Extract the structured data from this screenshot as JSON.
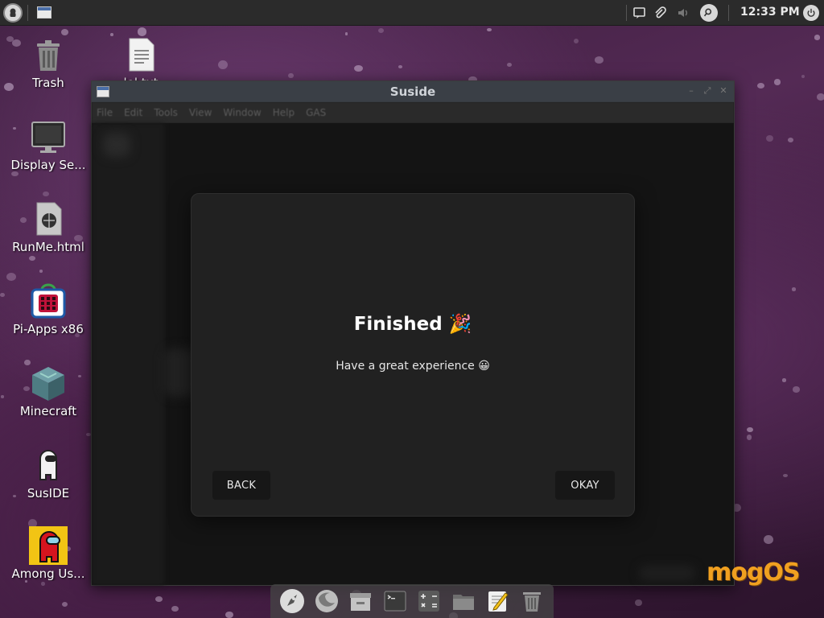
{
  "panel": {
    "clock": "12:33 PM",
    "tray_icons": [
      "notification-icon",
      "paperclip-icon",
      "volume-icon",
      "search-icon"
    ]
  },
  "desktop": {
    "icons": [
      {
        "label": "Trash",
        "icon": "trash-icon"
      },
      {
        "label": "Display Se...",
        "icon": "monitor-icon"
      },
      {
        "label": "RunMe.html",
        "icon": "html-file-icon"
      },
      {
        "label": "Pi-Apps x86",
        "icon": "pi-apps-icon"
      },
      {
        "label": "Minecraft",
        "icon": "minecraft-icon"
      },
      {
        "label": "SusIDE",
        "icon": "susIDE-icon"
      },
      {
        "label": "Among Us...",
        "icon": "among-us-icon"
      }
    ],
    "file_icon_label": "lol.txt",
    "brand": "mogOS"
  },
  "window": {
    "title": "Suside",
    "menu": [
      "File",
      "Edit",
      "Tools",
      "View",
      "Window",
      "Help",
      "GAS"
    ]
  },
  "dialog": {
    "title": "Finished 🎉",
    "message": "Have a great experience 😀",
    "back_label": "BACK",
    "okay_label": "OKAY"
  },
  "dock": {
    "items": [
      "launcher-icon",
      "firefox-icon",
      "files-icon",
      "terminal-icon",
      "calculator-icon",
      "folder-icon",
      "text-editor-icon",
      "trash-icon"
    ]
  },
  "colors": {
    "panel": "#2b2b2b",
    "dialog_bg": "#212121",
    "button_bg": "#171717",
    "brand": "#f0a020"
  }
}
